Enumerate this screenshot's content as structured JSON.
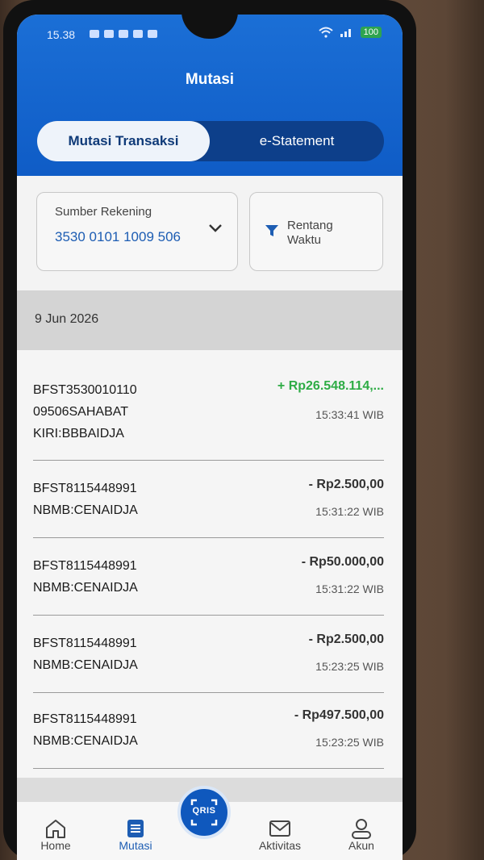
{
  "status_bar": {
    "time": "15.38",
    "battery": "100"
  },
  "header": {
    "title": "Mutasi"
  },
  "tabs": [
    {
      "label": "Mutasi Transaksi",
      "active": true
    },
    {
      "label": "e-Statement",
      "active": false
    }
  ],
  "filters": {
    "source_label": "Sumber Rekening",
    "source_value": "3530 0101 1009 506",
    "time_label": "Rentang Waktu"
  },
  "date_header": "9 Jun 2026",
  "transactions": [
    {
      "desc_lines": [
        "BFST3530010110",
        "09506SAHABAT",
        "KIRI:BBBAIDJA"
      ],
      "amount": "+ Rp26.548.114,...",
      "time": "15:33:41 WIB",
      "type": "credit"
    },
    {
      "desc_lines": [
        "BFST8115448991",
        "NBMB:CENAIDJA"
      ],
      "amount": "- Rp2.500,00",
      "time": "15:31:22 WIB",
      "type": "debit"
    },
    {
      "desc_lines": [
        "BFST8115448991",
        "NBMB:CENAIDJA"
      ],
      "amount": "- Rp50.000,00",
      "time": "15:31:22 WIB",
      "type": "debit"
    },
    {
      "desc_lines": [
        "BFST8115448991",
        "NBMB:CENAIDJA"
      ],
      "amount": "- Rp2.500,00",
      "time": "15:23:25 WIB",
      "type": "debit"
    },
    {
      "desc_lines": [
        "BFST8115448991",
        "NBMB:CENAIDJA"
      ],
      "amount": "- Rp497.500,00",
      "time": "15:23:25 WIB",
      "type": "debit"
    }
  ],
  "bottom_nav": {
    "items": [
      {
        "label": "Home",
        "icon": "home-icon"
      },
      {
        "label": "Mutasi",
        "icon": "receipt-icon",
        "active": true
      },
      {
        "label": "Aktivitas",
        "icon": "mail-icon"
      },
      {
        "label": "Akun",
        "icon": "user-icon"
      }
    ],
    "qris_label": "QRIS"
  },
  "colors": {
    "primary": "#1b6fd6",
    "credit": "#2eac45",
    "tab_dark": "#0d3f8a"
  }
}
